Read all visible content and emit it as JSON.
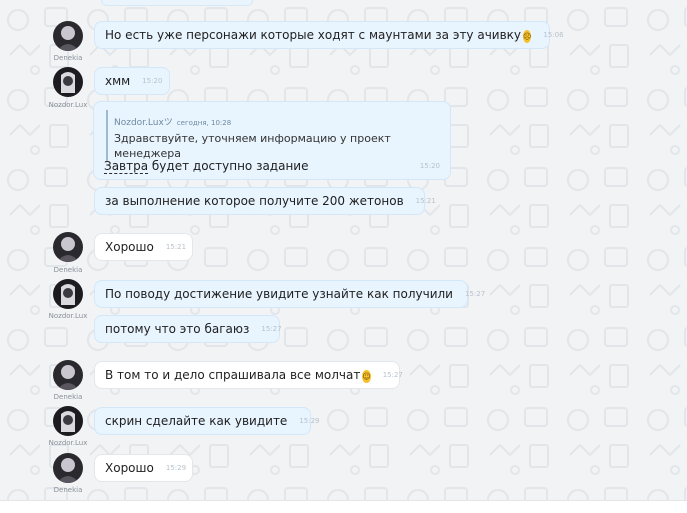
{
  "colors": {
    "chat_bg": "#f1f3f5",
    "bubble_out": "#e8f4fe",
    "bubble_in": "#ffffff",
    "time": "#b8c2cc"
  },
  "messages": [
    {
      "sender": "Denekia",
      "text": "Но есть уже персонажи которые ходят с маунтами за эту ачивку",
      "emoji": "confused-face",
      "time": "15:06"
    },
    {
      "sender": "Nozdor.Lux",
      "text": "хмм",
      "time": "15:20"
    },
    {
      "quote": {
        "author": "Nozdor.Luxツ",
        "date": "сегодня, 10:28",
        "text": "Здравствуйте, уточняем информацию у проект менеджера"
      },
      "link": "Завтра",
      "text_rest": " будет доступно задание",
      "time": "15:20"
    },
    {
      "text": "за выполнение которое получите 200 жетонов",
      "time": "15:21"
    },
    {
      "sender": "Denekia",
      "text": "Хорошо",
      "time": "15:21"
    },
    {
      "sender": "Nozdor.Lux",
      "text": "По поводу достижение увидите узнайте как получили",
      "time": "15:27"
    },
    {
      "text": "потому что это багаюз",
      "time": "15:27"
    },
    {
      "sender": "Denekia",
      "text": "В том то и дело спрашивала все молчат",
      "emoji": "grinning-sweat-face",
      "time": "15:27"
    },
    {
      "sender": "Nozdor.Lux",
      "text": "скрин сделайте как увидите",
      "time": "15:29"
    },
    {
      "sender": "Denekia",
      "text": "Хорошо",
      "time": "15:29"
    }
  ]
}
